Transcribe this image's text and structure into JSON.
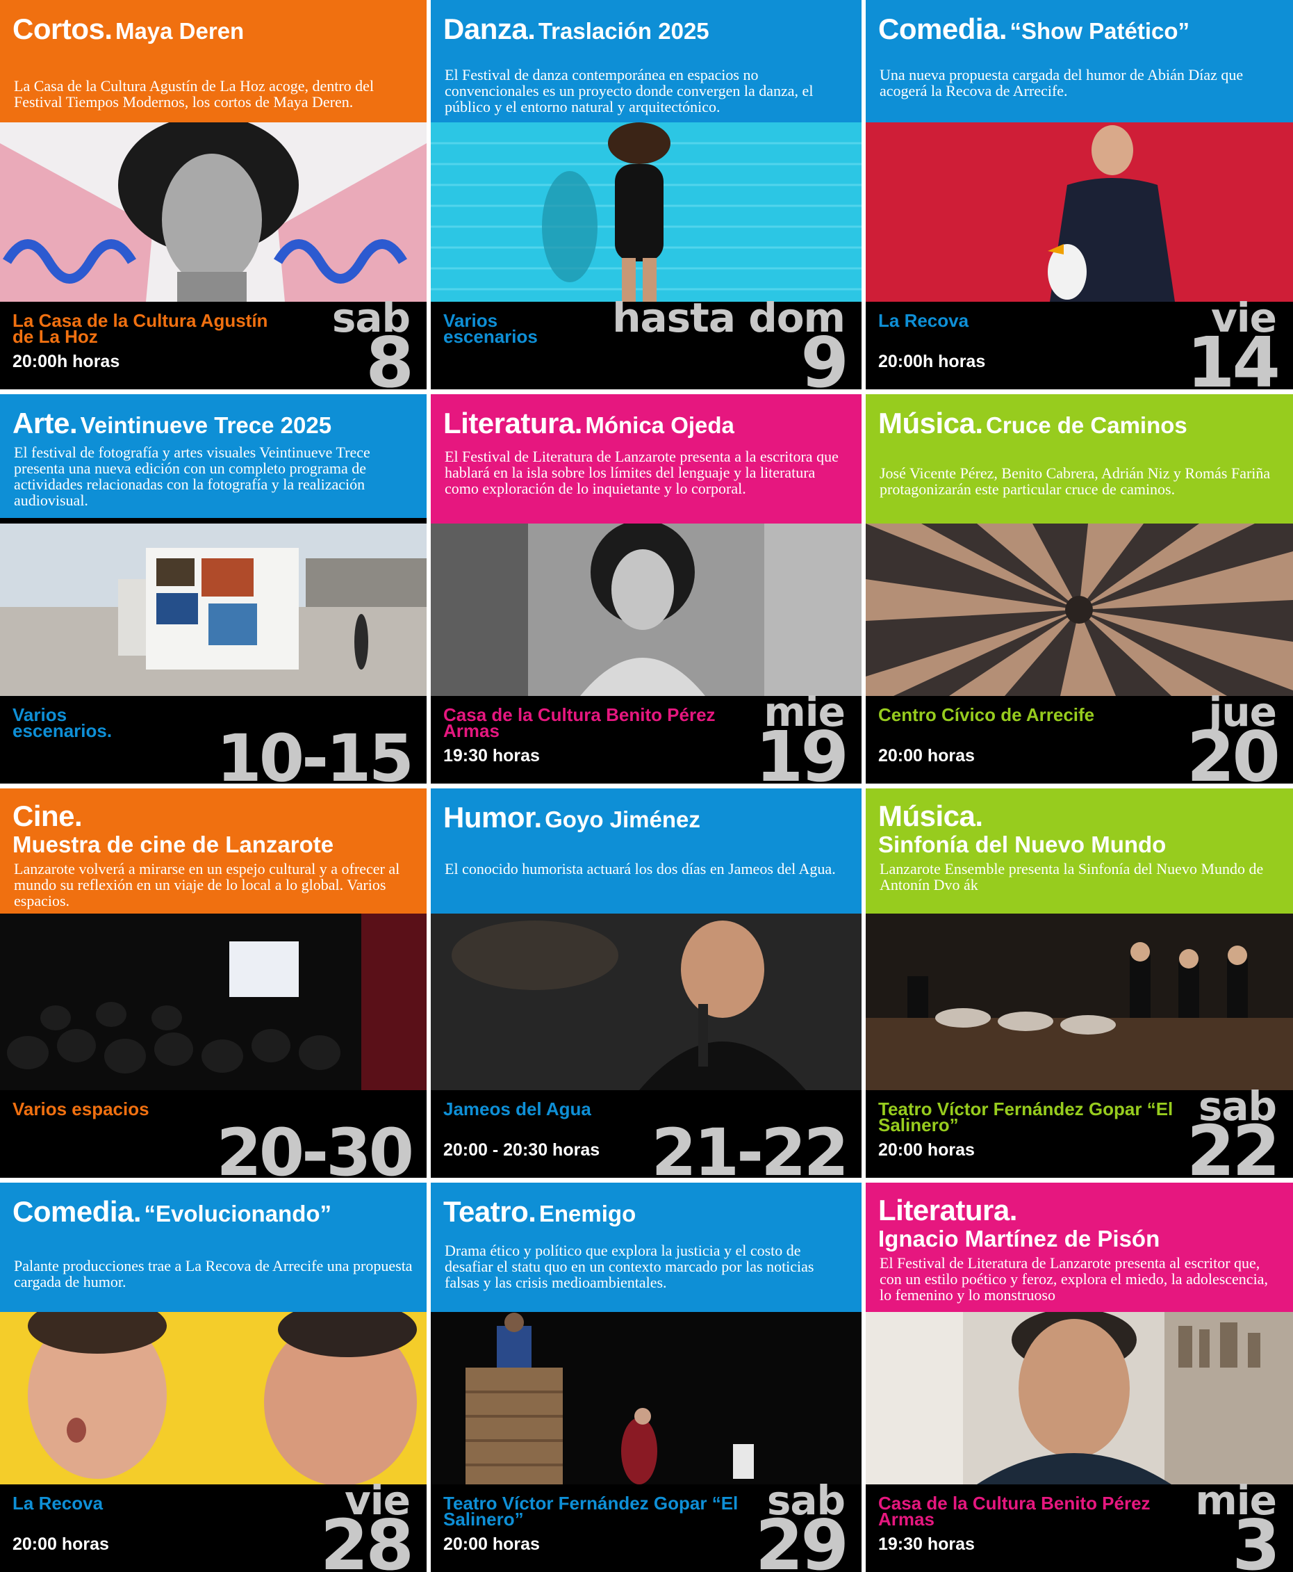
{
  "colors": {
    "orange": "#f07010",
    "blue": "#0e8fd6",
    "magenta": "#e6177f",
    "green": "#97cc1e",
    "black": "#000000",
    "date_gray": "#c8c8c8"
  },
  "events": [
    {
      "category": "Cortos.",
      "subtitle": "Maya Deren",
      "description": "La Casa de la Cultura Agustín de La Hoz acoge, dentro del Festival Tiempos Modernos, los cortos de Maya Deren.",
      "venue": "La Casa de la Cultura Agustín de La Hoz",
      "time": "20:00h horas",
      "weekday": "sab",
      "day": "8",
      "color": "orange"
    },
    {
      "category": "Danza.",
      "subtitle": "Traslación 2025",
      "description": "El Festival de danza contemporánea en espacios no convencionales es un proyecto donde convergen la danza, el público y el entorno natural y arquitectónico.",
      "venue": "Varios escenarios",
      "time": "",
      "weekday": "hasta dom",
      "day": "9",
      "color": "blue"
    },
    {
      "category": "Comedia.",
      "subtitle": "“Show Patético”",
      "description": "Una nueva propuesta cargada del humor de Abián Díaz que acogerá la Recova de Arrecife.",
      "venue": "La Recova",
      "time": "20:00h horas",
      "weekday": "vie",
      "day": "14",
      "color": "blue"
    },
    {
      "category": "Arte.",
      "subtitle": "Veintinueve Trece 2025",
      "description": "El festival de fotografía y artes visuales Veintinueve Trece presenta una nueva edición con un completo programa de actividades relacionadas con la fotografía y la realización audiovisual.",
      "venue": "Varios escenarios.",
      "time": "",
      "weekday": "",
      "day": "10-15",
      "color": "blue"
    },
    {
      "category": "Literatura.",
      "subtitle": "Mónica Ojeda",
      "description": "El Festival de Literatura de Lanzarote presenta a la escritora que hablará en la isla sobre los límites del lenguaje y la literatura como exploración de lo inquietante y lo corporal.",
      "venue": "Casa de la Cultura Benito Pérez Armas",
      "time": "19:30 horas",
      "weekday": "mie",
      "day": "19",
      "color": "magenta"
    },
    {
      "category": "Música.",
      "subtitle": "Cruce de Caminos",
      "description": "José Vicente Pérez, Benito Cabrera, Adrián Niz y Romás Fariña protagonizarán este particular cruce de caminos.",
      "venue": "Centro Cívico de Arrecife",
      "time": "20:00 horas",
      "weekday": "jue",
      "day": "20",
      "color": "green"
    },
    {
      "category": "Cine.",
      "subtitle": "Muestra de cine de Lanzarote",
      "description": "Lanzarote volverá a mirarse en un espejo cultural y a ofrecer al mundo su reflexión en un viaje de lo local a lo global. Varios espacios.",
      "venue": "Varios espacios",
      "time": "",
      "weekday": "",
      "day": "20-30",
      "color": "orange"
    },
    {
      "category": "Humor.",
      "subtitle": "Goyo Jiménez",
      "description": "El conocido humorista actuará los dos días en Jameos del Agua.",
      "venue": "Jameos del Agua",
      "time": "20:00 - 20:30 horas",
      "weekday": "",
      "day": "21-22",
      "color": "blue"
    },
    {
      "category": "Música.",
      "subtitle": "Sinfonía del Nuevo Mundo",
      "description": "Lanzarote Ensemble presenta la Sinfonía del Nuevo Mundo de Antonín Dvo ák",
      "venue": "Teatro Víctor Fernández Gopar “El Salinero”",
      "time": "20:00 horas",
      "weekday": "sab",
      "day": "22",
      "color": "green"
    },
    {
      "category": "Comedia.",
      "subtitle": "“Evolucionando”",
      "description": "Palante producciones trae a La Recova de Arrecife una propuesta cargada de humor.",
      "venue": "La Recova",
      "time": "20:00 horas",
      "weekday": "vie",
      "day": "28",
      "color": "blue"
    },
    {
      "category": "Teatro.",
      "subtitle": "Enemigo",
      "description": "Drama ético y político que explora la justicia y el costo de desafiar el statu quo en un contexto marcado por las noticias falsas y las crisis medioambientales.",
      "venue": "Teatro Víctor Fernández Gopar “El Salinero”",
      "time": "20:00 horas",
      "weekday": "sab",
      "day": "29",
      "color": "blue"
    },
    {
      "category": "Literatura.",
      "subtitle": "Ignacio Martínez de Pisón",
      "description": "El Festival de Literatura de Lanzarote presenta al escritor que, con un estilo poético y feroz, explora el miedo, la adolescencia, lo femenino y lo monstruoso",
      "venue": "Casa de la Cultura Benito Pérez Armas",
      "time": "19:30 horas",
      "weekday": "mie",
      "day": "3",
      "color": "magenta"
    }
  ]
}
